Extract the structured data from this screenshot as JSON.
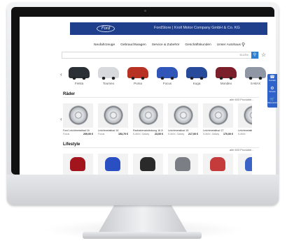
{
  "header": {
    "logo_text": "Ford",
    "title": "FordStore | Kroll Motor Company GmbH & Co. KG"
  },
  "nav": {
    "items": [
      "Neufahrzeuge",
      "Gebrauchtwagen",
      "Service & Zubehör",
      "Geschäftskunden",
      "Unser Autohaus"
    ]
  },
  "search": {
    "placeholder": "Suche"
  },
  "vehicles": [
    {
      "name": "Fiesta",
      "color": "#2b2f36"
    },
    {
      "name": "Tourneo",
      "color": "#d7d9dc"
    },
    {
      "name": "Puma",
      "color": "#b83224"
    },
    {
      "name": "Focus",
      "color": "#2f56b8"
    },
    {
      "name": "Kuga",
      "color": "#274a9b"
    },
    {
      "name": "Mondeo",
      "color": "#7b1f2a"
    },
    {
      "name": "S-MAX",
      "color": "#8e97a3"
    }
  ],
  "sections": {
    "wheels": {
      "title": "Räder",
      "more": "alle 603 Produkte..."
    },
    "lifestyle": {
      "title": "Lifestyle",
      "more": "alle 603 Produkte..."
    }
  },
  "wheels": [
    {
      "title": "Ford Leichtmetallrad 16",
      "model": "Focus",
      "price": "209,00 €"
    },
    {
      "title": "Leichtmetallrad 16",
      "model": "Focus",
      "price": "153,70 €"
    },
    {
      "title": "Radnabenabdeckung 16 Zoll",
      "model": "S-MAX, Galaxy",
      "price": "23,00 €"
    },
    {
      "title": "Leichtmetallrad 16",
      "model": "S-MAX, Galaxy",
      "price": "217,00 €"
    },
    {
      "title": "Leichtmetallrad 17",
      "model": "S-MAX, Galaxy",
      "price": "170,00 €"
    },
    {
      "title": "Leichtmetallrad",
      "model": "S-MAX",
      "price": ""
    }
  ],
  "lifestyle": [
    {
      "color": "#a3151c"
    },
    {
      "color": "#2a4fc2"
    },
    {
      "color": "#2a2a2a"
    },
    {
      "color": "#7b7f85"
    },
    {
      "color": "#c53a3a"
    },
    {
      "color": "#3b63c7"
    }
  ],
  "rail": {
    "buttons": [
      {
        "icon": "phone-icon",
        "label": "Kontakt"
      },
      {
        "icon": "gear-icon",
        "label": "Service"
      },
      {
        "icon": "cart-icon",
        "label": "Warenkorb"
      }
    ]
  }
}
